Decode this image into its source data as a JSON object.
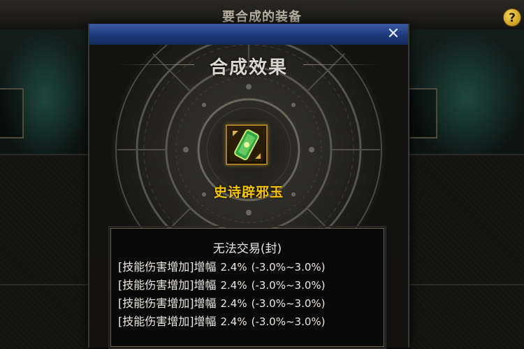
{
  "background_window": {
    "title": "要合成的装备",
    "help_icon": "help-icon",
    "help_label": "?"
  },
  "dialog": {
    "close_icon": "close-icon",
    "close_label": "✕",
    "section_title": "合成效果",
    "item": {
      "name": "史诗辟邪玉",
      "icon": "jade-charm-icon",
      "name_color": "#f5c400"
    },
    "info": {
      "heading": "无法交易(封)",
      "stats": [
        {
          "name": "[技能伤害增加]增幅",
          "value": "2.4%",
          "range": "(-3.0%~3.0%)"
        },
        {
          "name": "[技能伤害增加]增幅",
          "value": "2.4%",
          "range": "(-3.0%~3.0%)"
        },
        {
          "name": "[技能伤害增加]增幅",
          "value": "2.4%",
          "range": "(-3.0%~3.0%)"
        },
        {
          "name": "[技能伤害增加]增幅",
          "value": "2.4%",
          "range": "(-3.0%~3.0%)"
        }
      ]
    }
  },
  "colors": {
    "titlebar_blue": "#1d3a7c",
    "item_border_gold": "#a67c20",
    "text_light": "#e9e7e1"
  }
}
